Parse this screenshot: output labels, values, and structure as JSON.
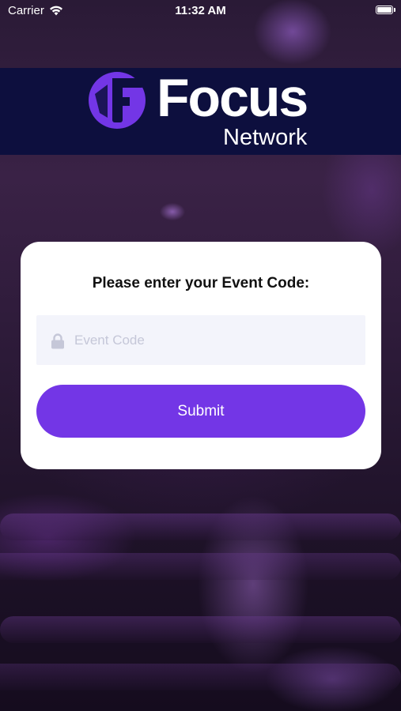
{
  "status_bar": {
    "carrier": "Carrier",
    "time": "11:32 AM"
  },
  "logo": {
    "wordmark": "Focus",
    "subtitle": "Network",
    "brand_color": "#7336e6",
    "band_color": "#0d0f3e"
  },
  "card": {
    "title": "Please enter your Event Code:",
    "event_code_field": {
      "placeholder": "Event Code",
      "value": "",
      "icon": "lock-icon"
    },
    "submit_label": "Submit"
  },
  "icons": {
    "wifi": "wifi-icon",
    "battery": "battery-icon"
  }
}
